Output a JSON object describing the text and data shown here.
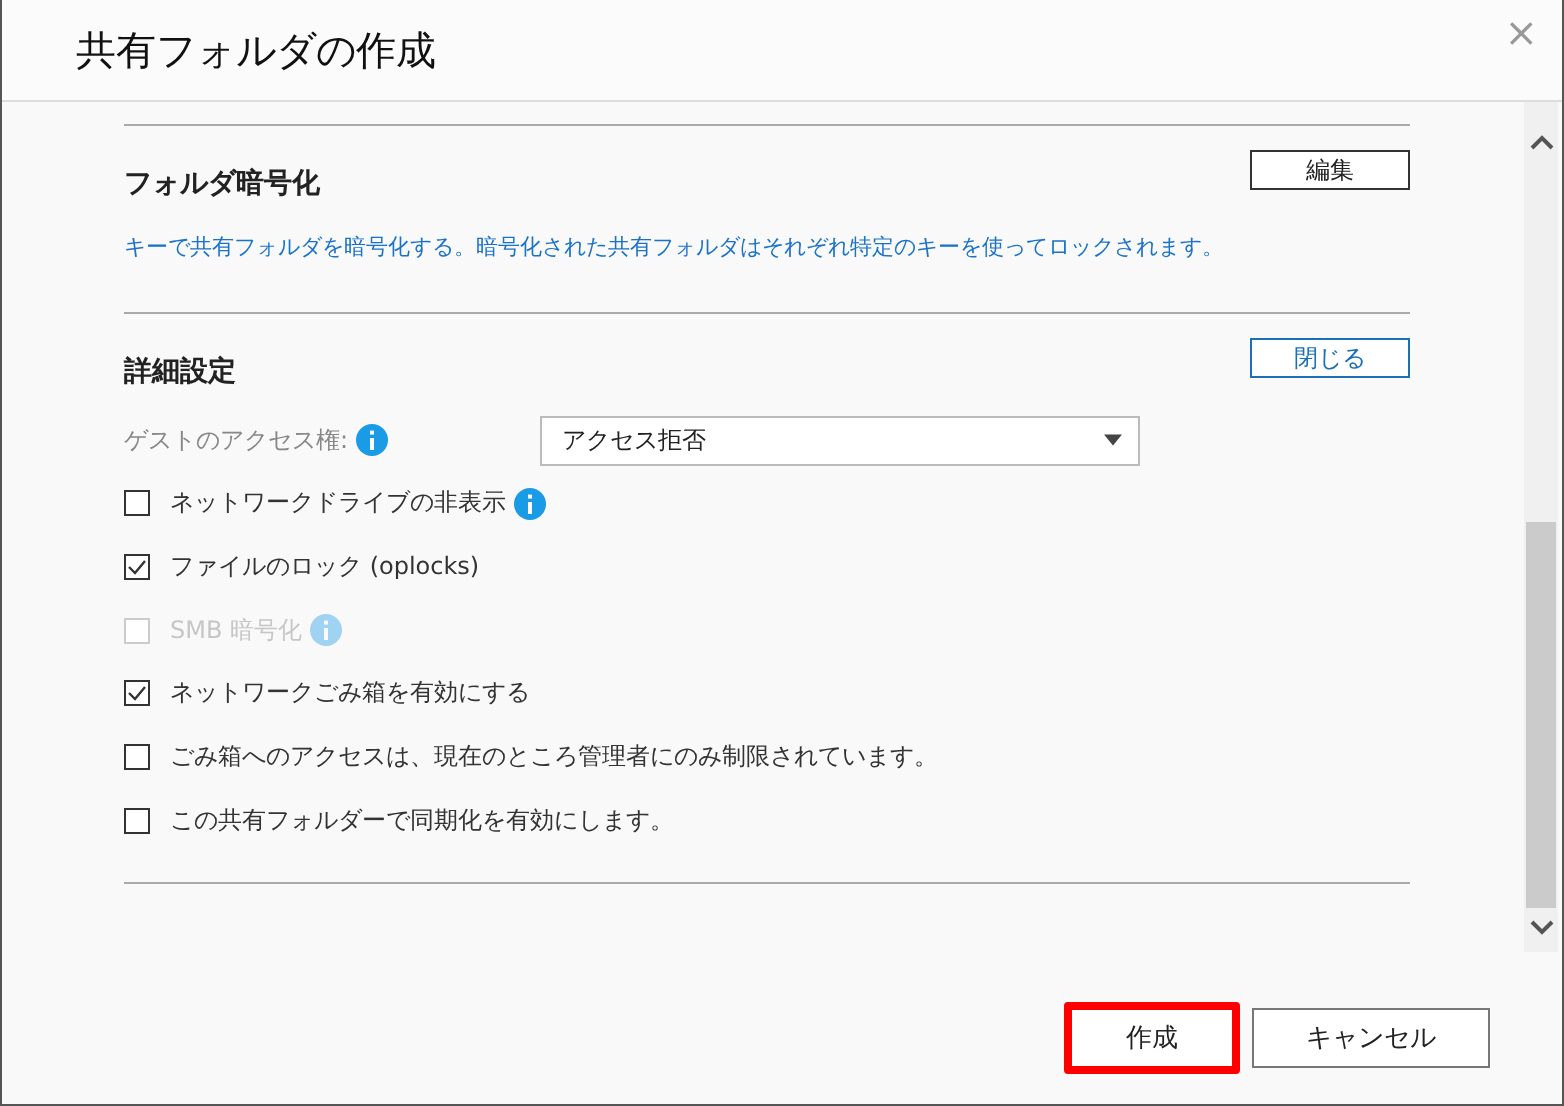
{
  "window": {
    "title": "共有フォルダの作成",
    "close": "×"
  },
  "encryption": {
    "title": "フォルダ暗号化",
    "button": "編集",
    "description": "キーで共有フォルダを暗号化する。暗号化された共有フォルダはそれぞれ特定のキーを使ってロックされます。"
  },
  "advanced": {
    "title": "詳細設定",
    "button": "閉じる",
    "guest_access": {
      "label": "ゲストのアクセス権:",
      "value": "アクセス拒否"
    },
    "options": [
      {
        "label": "ネットワークドライブの非表示",
        "checked": false,
        "disabled": false,
        "info": true
      },
      {
        "label": "ファイルのロック (oplocks)",
        "checked": true,
        "disabled": false,
        "info": false
      },
      {
        "label": "SMB 暗号化",
        "checked": false,
        "disabled": true,
        "info": true
      },
      {
        "label": "ネットワークごみ箱を有効にする",
        "checked": true,
        "disabled": false,
        "info": false
      },
      {
        "label": "ごみ箱へのアクセスは、現在のところ管理者にのみ制限されています。",
        "checked": false,
        "disabled": false,
        "info": false
      },
      {
        "label": "この共有フォルダーで同期化を有効にします。",
        "checked": false,
        "disabled": false,
        "info": false
      }
    ]
  },
  "buttons": [
    {
      "label": "作成",
      "highlighted": true
    },
    {
      "label": "キャンセル",
      "highlighted": false
    }
  ]
}
